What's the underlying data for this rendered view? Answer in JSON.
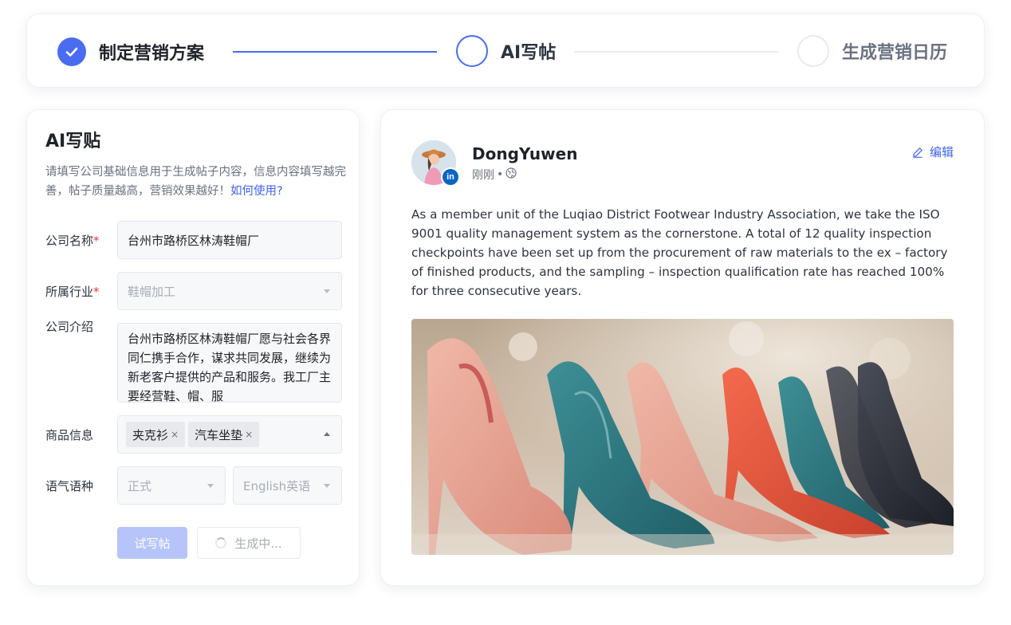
{
  "stepper": {
    "steps": [
      {
        "label": "制定营销方案",
        "state": "done"
      },
      {
        "label": "AI写帖",
        "state": "active"
      },
      {
        "label": "生成营销日历",
        "state": "todo"
      }
    ]
  },
  "form": {
    "title": "AI写贴",
    "description": "请填写公司基础信息用于生成帖子内容，信息内容填写越完善，帖子质量越高，营销效果越好！",
    "help_link": "如何使用?",
    "company_name": {
      "label": "公司名称",
      "required_mark": "*",
      "value": "台州市路桥区林涛鞋帽厂"
    },
    "industry": {
      "label": "所属行业",
      "required_mark": "*",
      "placeholder": "鞋帽加工"
    },
    "intro": {
      "label": "公司介绍",
      "value": "台州市路桥区林涛鞋帽厂愿与社会各界同仁携手合作，谋求共同发展，继续为新老客户提供的产品和服务。我工厂主要经营鞋、帽、服"
    },
    "products": {
      "label": "商品信息",
      "tags": [
        "夹克衫",
        "汽车坐垫"
      ]
    },
    "tone_language": {
      "label": "语气语种",
      "tone": "正式",
      "language": "English英语"
    },
    "try_button": "试写帖",
    "generating_button": "生成中..."
  },
  "preview": {
    "author": "DongYuwen",
    "time": "刚刚",
    "separator": "•",
    "edit_label": "编辑",
    "post_text": "As a member unit of the Luqiao District Footwear Industry Association, we take the ISO 9001 quality management system as the cornerstone. A total of 12 quality inspection checkpoints have been set up from the procurement of raw materials to the ex – factory of finished products, and the sampling – inspection qualification rate has reached 100% for three consecutive years.",
    "badge": "in"
  },
  "colors": {
    "accent": "#4a6cf0",
    "link": "#3d63f1",
    "required": "#e53935",
    "primary_disabled": "#b6c4fa",
    "linkedin": "#0a66c2"
  }
}
